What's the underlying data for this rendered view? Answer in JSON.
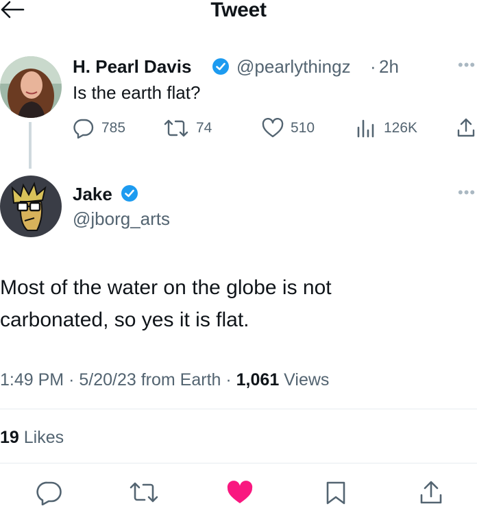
{
  "header": {
    "title": "Tweet"
  },
  "parent_tweet": {
    "name": "H. Pearl Davis",
    "handle": "@pearlythingz",
    "separator": "·",
    "age": "2h",
    "text": "Is the earth flat?",
    "stats": {
      "replies": "785",
      "retweets": "74",
      "likes": "510",
      "views": "126K"
    }
  },
  "reply_tweet": {
    "name": "Jake",
    "handle": "@jborg_arts",
    "text": "Most of the water on the globe is not carbonated, so yes it is flat.",
    "time": "1:49 PM",
    "date": "5/20/23",
    "source": "from Earth",
    "dot": "·",
    "views_count": "1,061",
    "views_label": "Views",
    "likes_count": "19",
    "likes_label": "Likes"
  },
  "colors": {
    "verified": "#1d9bf0",
    "like_active": "#f91880",
    "text_secondary": "#536471"
  },
  "icons": {
    "back": "arrow-left-icon",
    "verified": "verified-badge-icon",
    "more": "more-icon",
    "reply": "reply-icon",
    "retweet": "retweet-icon",
    "like": "heart-icon",
    "views": "analytics-icon",
    "share": "share-icon",
    "bookmark": "bookmark-icon"
  }
}
